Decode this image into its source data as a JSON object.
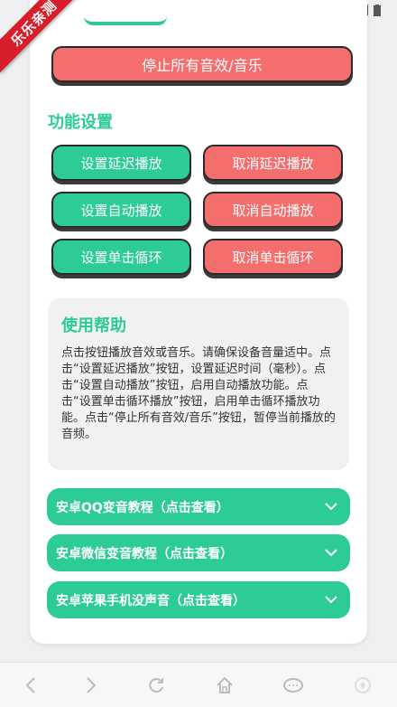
{
  "badge": "乐乐亲测",
  "stop_all_label": "停止所有音效/音乐",
  "section_title": "功能设置",
  "buttons": {
    "set_delay": "设置延迟播放",
    "cancel_delay": "取消延迟播放",
    "set_auto": "设置自动播放",
    "cancel_auto": "取消自动播放",
    "set_loop": "设置单击循环",
    "cancel_loop": "取消单击循环"
  },
  "help": {
    "title": "使用帮助",
    "text": "点击按钮播放音效或音乐。请确保设备音量适中。点击“设置延迟播放”按钮，设置延迟时间（毫秒）。点击“设置自动播放”按钮，启用自动播放功能。点击“设置单击循环播放”按钮，启用单击循环播放功能。点击“停止所有音效/音乐”按钮，暂停当前播放的音频。"
  },
  "accordions": [
    {
      "label": "安卓QQ变音教程（点击查看）"
    },
    {
      "label": "安卓微信变音教程（点击查看）"
    },
    {
      "label": "安卓苹果手机没声音（点击查看）"
    }
  ],
  "colors": {
    "green": "#2dcb95",
    "red": "#f46e6e",
    "badge": "#d81e2a"
  }
}
